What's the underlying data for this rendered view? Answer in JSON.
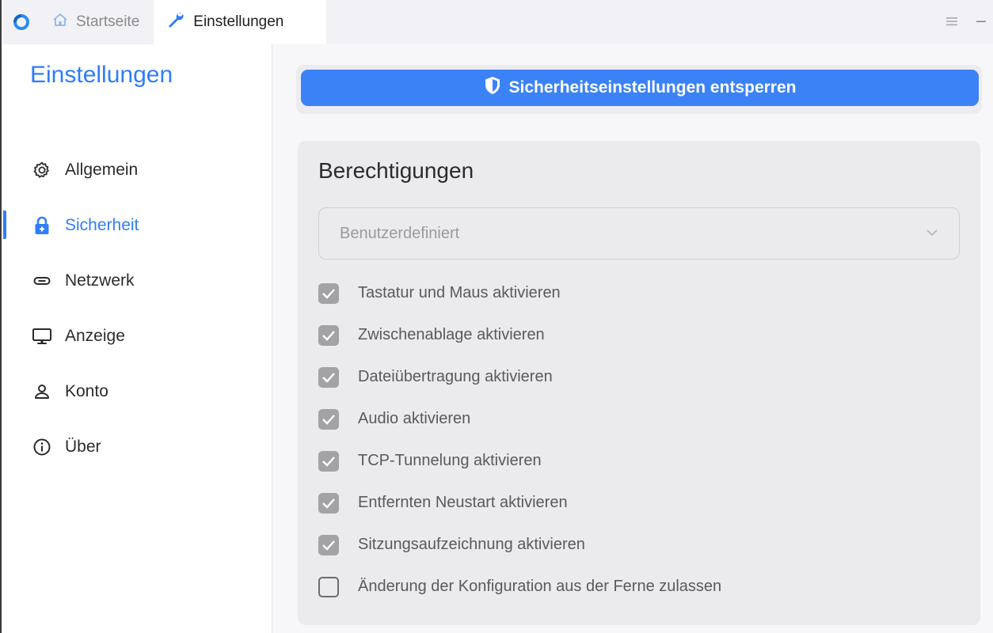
{
  "titlebar": {
    "tabs": [
      {
        "label": "Startseite",
        "icon": "home-icon",
        "active": false
      },
      {
        "label": "Einstellungen",
        "icon": "wrench-icon",
        "active": true
      }
    ],
    "controls": {
      "menu_icon": "menu-icon",
      "minimize_icon": "minimize-icon"
    }
  },
  "sidebar": {
    "title": "Einstellungen",
    "items": [
      {
        "label": "Allgemein",
        "icon": "gear-icon"
      },
      {
        "label": "Sicherheit",
        "icon": "lock-icon",
        "active": true
      },
      {
        "label": "Netzwerk",
        "icon": "link-icon"
      },
      {
        "label": "Anzeige",
        "icon": "monitor-icon"
      },
      {
        "label": "Konto",
        "icon": "user-icon"
      },
      {
        "label": "Über",
        "icon": "info-icon"
      }
    ]
  },
  "main": {
    "unlock_button": "Sicherheitseinstellungen entsperren",
    "permissions": {
      "title": "Berechtigungen",
      "preset_value": "Benutzerdefiniert",
      "options": [
        {
          "label": "Tastatur und Maus aktivieren",
          "checked": true
        },
        {
          "label": "Zwischenablage aktivieren",
          "checked": true
        },
        {
          "label": "Dateiübertragung aktivieren",
          "checked": true
        },
        {
          "label": "Audio aktivieren",
          "checked": true
        },
        {
          "label": "TCP-Tunnelung aktivieren",
          "checked": true
        },
        {
          "label": "Entfernten Neustart aktivieren",
          "checked": true
        },
        {
          "label": "Sitzungsaufzeichnung aktivieren",
          "checked": true
        },
        {
          "label": "Änderung der Konfiguration aus der Ferne zulassen",
          "checked": false
        }
      ]
    }
  },
  "colors": {
    "accent": "#2f7dfb",
    "button": "#3b82f6",
    "checkbox_checked": "#a3a3a6"
  }
}
